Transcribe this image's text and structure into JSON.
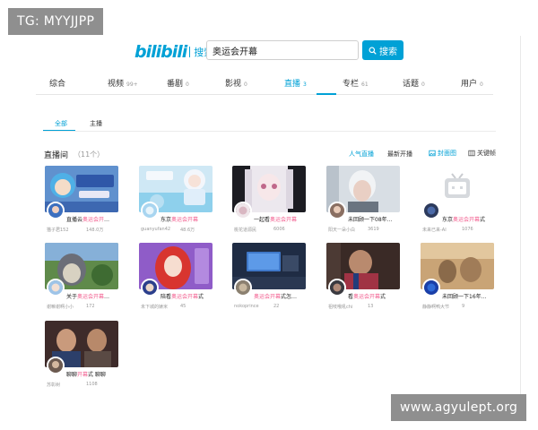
{
  "watermarks": {
    "top_left": "TG: MYYJJPP",
    "bottom_right": "www.agyulept.org"
  },
  "header": {
    "logo_text": "bilibili",
    "logo_sub": "搜索"
  },
  "search": {
    "value": "奥运会开幕",
    "button_label": "搜索",
    "button_icon": "search-icon"
  },
  "tabs": [
    {
      "label": "综合",
      "count": ""
    },
    {
      "label": "视频",
      "count": "99+"
    },
    {
      "label": "番剧",
      "count": "0"
    },
    {
      "label": "影视",
      "count": "0"
    },
    {
      "label": "直播",
      "count": "3"
    },
    {
      "label": "专栏",
      "count": "61"
    },
    {
      "label": "话题",
      "count": "0"
    },
    {
      "label": "用户",
      "count": "0"
    }
  ],
  "subtabs": [
    {
      "label": "全部"
    },
    {
      "label": "主播"
    }
  ],
  "live_section": {
    "title": "直播间",
    "count": "（11个）"
  },
  "sort_options": [
    {
      "label": "人气直播"
    },
    {
      "label": "最新开播"
    }
  ],
  "view_options": [
    {
      "label": "封面图",
      "icon": "image-icon"
    },
    {
      "label": "关键帧",
      "icon": "frame-icon"
    }
  ],
  "cards": [
    {
      "title_pre": "直播云",
      "title_hl": "奥运会开",
      "title_post": "…",
      "uploader": "猫子君152",
      "count": "148.0万"
    },
    {
      "title_pre": "东京",
      "title_hl": "奥运会开幕",
      "title_post": "",
      "uploader": "guanyufan42",
      "count": "48.6万"
    },
    {
      "title_pre": "一起看",
      "title_hl": "奥运会开幕",
      "title_post": "",
      "uploader": "桃花道源民",
      "count": "6006"
    },
    {
      "title_pre": "未回顾一下08年…",
      "title_hl": "",
      "title_post": "",
      "uploader": "阳天一朵小白",
      "count": "3619"
    },
    {
      "title_pre": "东京",
      "title_hl": "奥运会开幕",
      "title_post": "式",
      "uploader": "未来已来-AI",
      "count": "1076"
    },
    {
      "title_pre": "关于",
      "title_hl": "奥运会开幕",
      "title_post": "…",
      "uploader": "谢嘛谢啊小小",
      "count": "172"
    },
    {
      "title_pre": "陪看",
      "title_hl": "奥运会开幕",
      "title_post": "式",
      "uploader": "未下城的婊米",
      "count": "45"
    },
    {
      "title_pre": "",
      "title_hl": "奥运会开幕",
      "title_post": "式怎…",
      "uploader": "nokoprince",
      "count": "22"
    },
    {
      "title_pre": "看",
      "title_hl": "奥运会开幕",
      "title_post": "式",
      "uploader": "祖吱哦吼chi",
      "count": "13"
    },
    {
      "title_pre": "未回顾一下16年…",
      "title_hl": "",
      "title_post": "",
      "uploader": "静静啊鸭大节",
      "count": "9"
    },
    {
      "title_pre": "聊聊",
      "title_hl": "开幕",
      "title_post": "式 聊聊",
      "uploader": "苏彰树",
      "count": "1108"
    }
  ],
  "colors": {
    "accent": "#00a1d6",
    "highlight": "#f25d8e"
  }
}
